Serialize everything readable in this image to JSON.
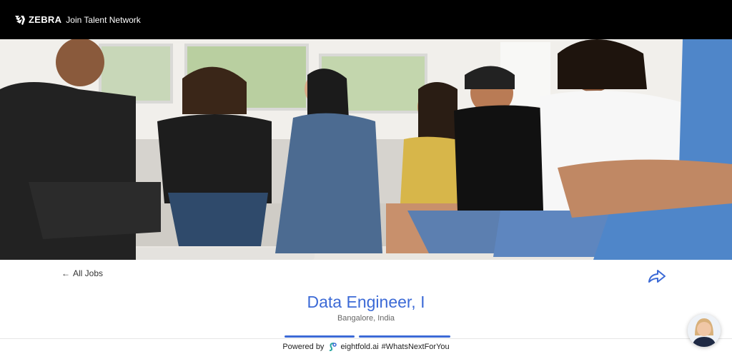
{
  "header": {
    "brand": "ZEBRA",
    "join_link": "Join Talent Network"
  },
  "nav": {
    "back_label": "All Jobs",
    "back_arrow": "←",
    "share_icon": "share-arrow-icon"
  },
  "job": {
    "title": "Data Engineer, I",
    "location": "Bangalore, India"
  },
  "footer": {
    "powered_by": "Powered by",
    "provider": "eightfold.ai",
    "hashtag": "#WhatsNextForYou"
  },
  "colors": {
    "header_bg": "#000000",
    "accent": "#3c6ad6",
    "text": "#333333"
  }
}
